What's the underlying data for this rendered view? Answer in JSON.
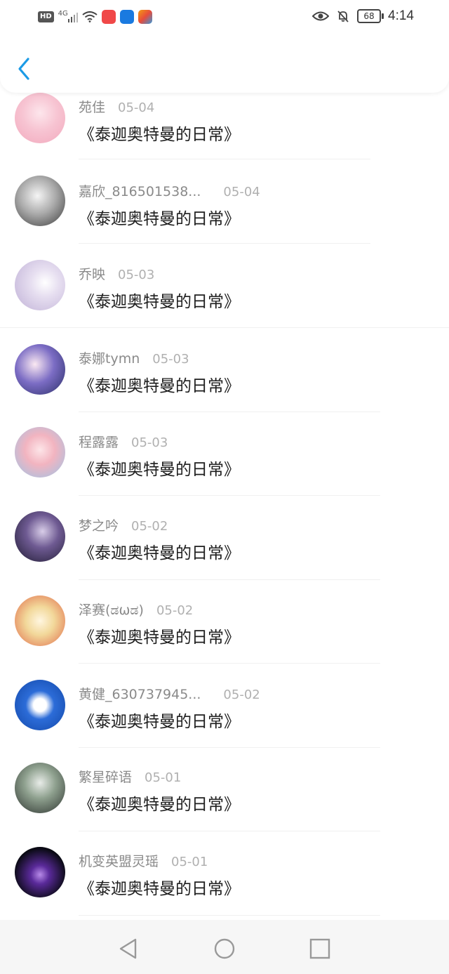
{
  "statusbar": {
    "hd": "HD",
    "network": "4G",
    "battery": "68",
    "time": "4:14",
    "icons": [
      "signal-icon",
      "wifi-icon",
      "shop-app-icon",
      "bulb-app-icon",
      "tools-app-icon",
      "eye-icon",
      "bell-off-icon"
    ],
    "colors": {
      "shop": "#f04848",
      "bulb": "#1a7ae0",
      "tools": "#f39c12"
    }
  },
  "header": {
    "back_icon": "chevron-left-icon",
    "accent": "#1c9be6"
  },
  "items": [
    {
      "name": "苑佳",
      "date": "05-04",
      "title": "《泰迦奥特曼的日常》"
    },
    {
      "name": "嘉欣_816501538...",
      "date": "05-04",
      "title": "《泰迦奥特曼的日常》"
    },
    {
      "name": "乔映",
      "date": "05-03",
      "title": "《泰迦奥特曼的日常》"
    },
    {
      "name": "泰娜tymn",
      "date": "05-03",
      "title": "《泰迦奥特曼的日常》"
    },
    {
      "name": "程露露",
      "date": "05-03",
      "title": "《泰迦奥特曼的日常》"
    },
    {
      "name": "梦之吟",
      "date": "05-02",
      "title": "《泰迦奥特曼的日常》"
    },
    {
      "name": "泽赛(ಡωಡ)",
      "date": "05-02",
      "title": "《泰迦奥特曼的日常》"
    },
    {
      "name": "黄健_630737945...",
      "date": "05-02",
      "title": "《泰迦奥特曼的日常》"
    },
    {
      "name": "繁星碎语",
      "date": "05-01",
      "title": "《泰迦奥特曼的日常》"
    },
    {
      "name": "机变英盟灵瑶",
      "date": "05-01",
      "title": "《泰迦奥特曼的日常》"
    }
  ],
  "navbar": {
    "icons": [
      "back-triangle-icon",
      "home-circle-icon",
      "recents-square-icon"
    ]
  }
}
